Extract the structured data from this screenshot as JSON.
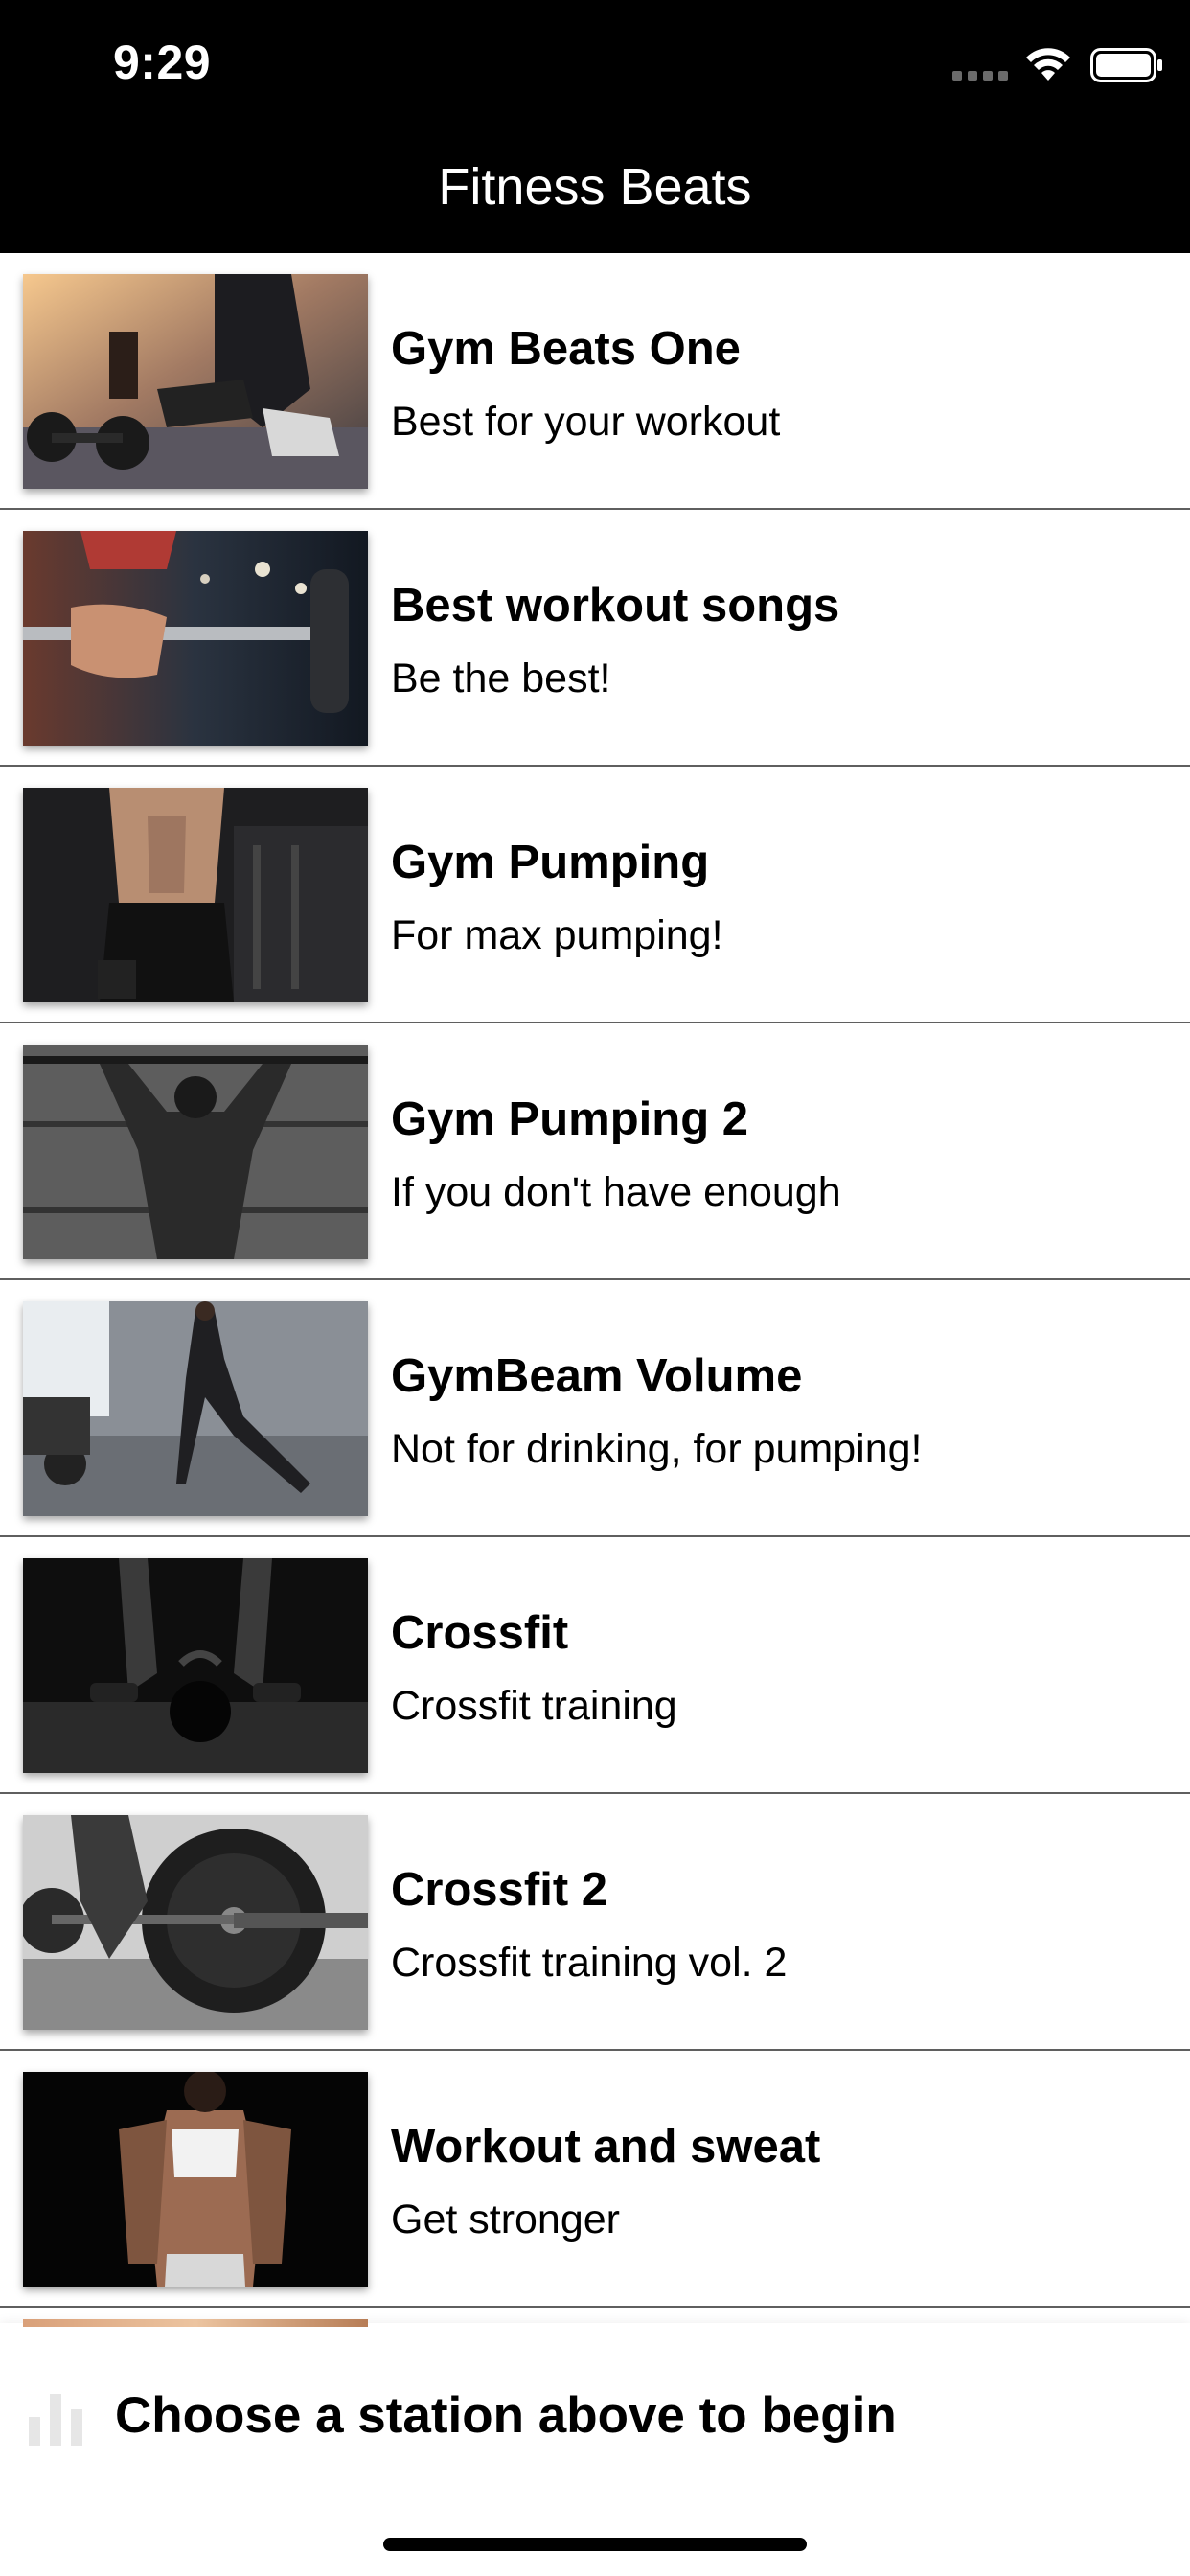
{
  "status_bar": {
    "time": "9:29"
  },
  "nav": {
    "title": "Fitness Beats"
  },
  "stations": [
    {
      "title": "Gym Beats One",
      "subtitle": "Best for your workout",
      "thumb": "dumbbell-shoes"
    },
    {
      "title": "Best workout songs",
      "subtitle": "Be the best!",
      "thumb": "barbell-grip"
    },
    {
      "title": "Gym Pumping",
      "subtitle": "For max pumping!",
      "thumb": "torso-abs"
    },
    {
      "title": "Gym Pumping 2",
      "subtitle": "If you don't have enough",
      "thumb": "pullup-back"
    },
    {
      "title": "GymBeam Volume",
      "subtitle": "Not for drinking, for pumping!",
      "thumb": "lunge-woman"
    },
    {
      "title": "Crossfit",
      "subtitle": "Crossfit training",
      "thumb": "kettlebell"
    },
    {
      "title": "Crossfit 2",
      "subtitle": "Crossfit training vol. 2",
      "thumb": "weight-plate"
    },
    {
      "title": "Workout and sweat",
      "subtitle": "Get stronger",
      "thumb": "woman-abs"
    }
  ],
  "player": {
    "prompt": "Choose a station above to begin",
    "icon": "equalizer-icon"
  }
}
